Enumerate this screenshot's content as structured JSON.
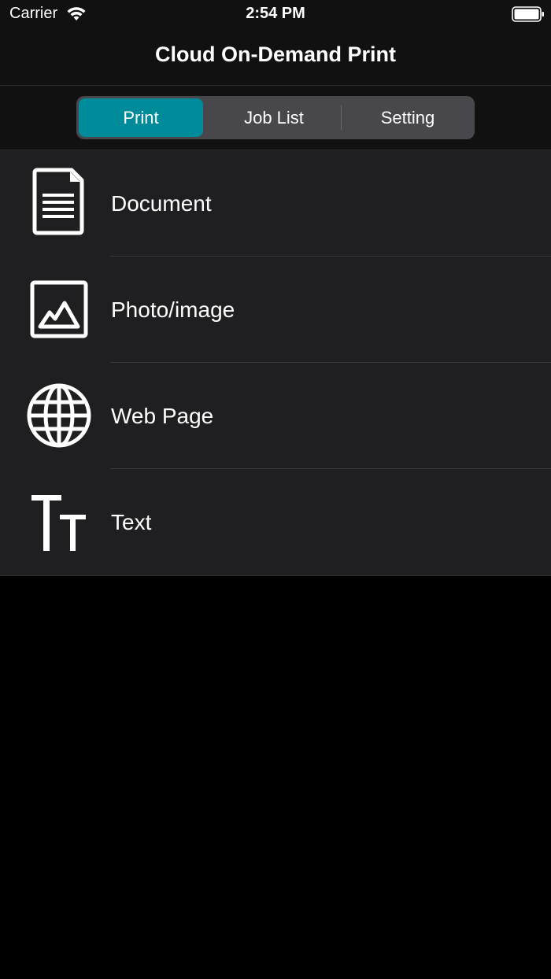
{
  "status_bar": {
    "carrier": "Carrier",
    "time": "2:54 PM",
    "wifi_icon": "wifi-icon",
    "battery_icon": "battery-icon"
  },
  "nav": {
    "title": "Cloud On-Demand Print"
  },
  "tabs": [
    {
      "label": "Print",
      "selected": true
    },
    {
      "label": "Job List",
      "selected": false
    },
    {
      "label": "Setting",
      "selected": false
    }
  ],
  "menu": [
    {
      "label": "Document",
      "icon": "document-icon"
    },
    {
      "label": "Photo/image",
      "icon": "photo-icon"
    },
    {
      "label": "Web Page",
      "icon": "globe-icon"
    },
    {
      "label": "Text",
      "icon": "text-icon"
    }
  ],
  "colors": {
    "accent": "#008b9a",
    "background": "#000000",
    "list_background": "#1f1f21",
    "segment_background": "#48484c"
  }
}
